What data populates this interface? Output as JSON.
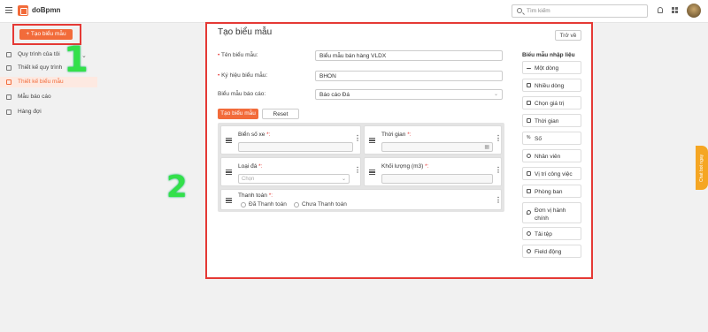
{
  "app": {
    "name": "doBpmn"
  },
  "header": {
    "search_placeholder": "Tìm kiếm"
  },
  "sidebar": {
    "create_button": "+ Tạo biểu mẫu",
    "items": [
      {
        "label": "Quy trình của tôi",
        "has_chevron": true
      },
      {
        "label": "Thiết kế quy trình",
        "has_chevron": true
      },
      {
        "label": "Thiết kế biểu mẫu",
        "active": true
      },
      {
        "label": "Mẫu báo cáo"
      },
      {
        "label": "Hàng đợi"
      }
    ]
  },
  "annotations": {
    "one": "1",
    "two": "2"
  },
  "form": {
    "title": "Tạo biểu mẫu",
    "back_button": "Trở về",
    "fields": [
      {
        "label": "Tên biểu mẫu:",
        "required": true,
        "value": "Biểu mẫu bán hàng VLDX"
      },
      {
        "label": "Ký hiệu biểu mẫu:",
        "required": true,
        "value": "BHON"
      },
      {
        "label": "Biểu mẫu báo cáo:",
        "required": false,
        "value": "Báo cáo Đá"
      }
    ],
    "tabs": {
      "create": "Tạo biểu mẫu",
      "reset": "Reset"
    },
    "cards": {
      "plate": {
        "label": "Biển số xe",
        "req": "*:"
      },
      "time": {
        "label": "Thời gian",
        "req": "*:"
      },
      "stone": {
        "label": "Loại đá",
        "req": "*:",
        "placeholder": "Chọn"
      },
      "weight": {
        "label": "Khối lượng (m3)",
        "req": "*:"
      },
      "payment": {
        "label": "Thanh toán",
        "req": "*:",
        "options": [
          "Đã Thanh toán",
          "Chưa Thanh toán"
        ]
      }
    }
  },
  "toolbox": {
    "title": "Biểu mẫu nhập liệu",
    "items": [
      {
        "label": "Một dòng",
        "icon": "line-icon"
      },
      {
        "label": "Nhiều dòng",
        "icon": "multiline-icon"
      },
      {
        "label": "Chọn giá trị",
        "icon": "checkbox-icon"
      },
      {
        "label": "Thời gian",
        "icon": "calendar-icon"
      },
      {
        "label": "Số",
        "icon": "number-icon"
      },
      {
        "label": "Nhân viên",
        "icon": "person-icon"
      },
      {
        "label": "Vị trí công việc",
        "icon": "position-icon"
      },
      {
        "label": "Phòng ban",
        "icon": "org-icon"
      },
      {
        "label": "Đơn vị hành chính",
        "label_line2": "chính.",
        "icon": "location-icon"
      },
      {
        "label": "Tải tệp",
        "icon": "upload-icon"
      },
      {
        "label": "Field động",
        "icon": "dynamic-field-icon"
      }
    ]
  },
  "chatbot": {
    "label": "Chat bot ngay"
  }
}
